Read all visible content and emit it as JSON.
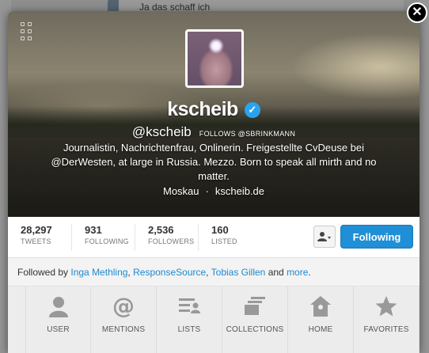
{
  "background": {
    "peek_text": "Ja das schaff ich"
  },
  "profile": {
    "name": "kscheib",
    "handle": "@kscheib",
    "follows_badge": "FOLLOWS @SBRINKMANN",
    "bio": "Journalistin, Nachrichtenfrau, Onlinerin. Freigestellte CvDeuse bei @DerWesten, at large in Russia. Mezzo. Born to speak all mirth and no matter.",
    "location": "Moskau",
    "separator": "·",
    "website": "kscheib.de"
  },
  "stats": [
    {
      "value": "28,297",
      "label": "TWEETS"
    },
    {
      "value": "931",
      "label": "FOLLOWING"
    },
    {
      "value": "2,536",
      "label": "FOLLOWERS"
    },
    {
      "value": "160",
      "label": "LISTED"
    }
  ],
  "actions": {
    "following_label": "Following"
  },
  "followed_by": {
    "prefix": "Followed by",
    "users": [
      "Inga Methling",
      "ResponseSource",
      "Tobias Gillen"
    ],
    "sep1": ",",
    "sep2": ",",
    "and": "and",
    "more": "more",
    "end": "."
  },
  "nav": [
    {
      "label": "USER",
      "icon": "user-icon"
    },
    {
      "label": "MENTIONS",
      "icon": "at-icon"
    },
    {
      "label": "LISTS",
      "icon": "lists-icon"
    },
    {
      "label": "COLLECTIONS",
      "icon": "collections-icon"
    },
    {
      "label": "HOME",
      "icon": "home-icon"
    },
    {
      "label": "FAVORITES",
      "icon": "star-icon"
    }
  ],
  "colors": {
    "accent": "#1f8fd6",
    "link": "#1c8ad0",
    "verified": "#2aa3ef"
  }
}
